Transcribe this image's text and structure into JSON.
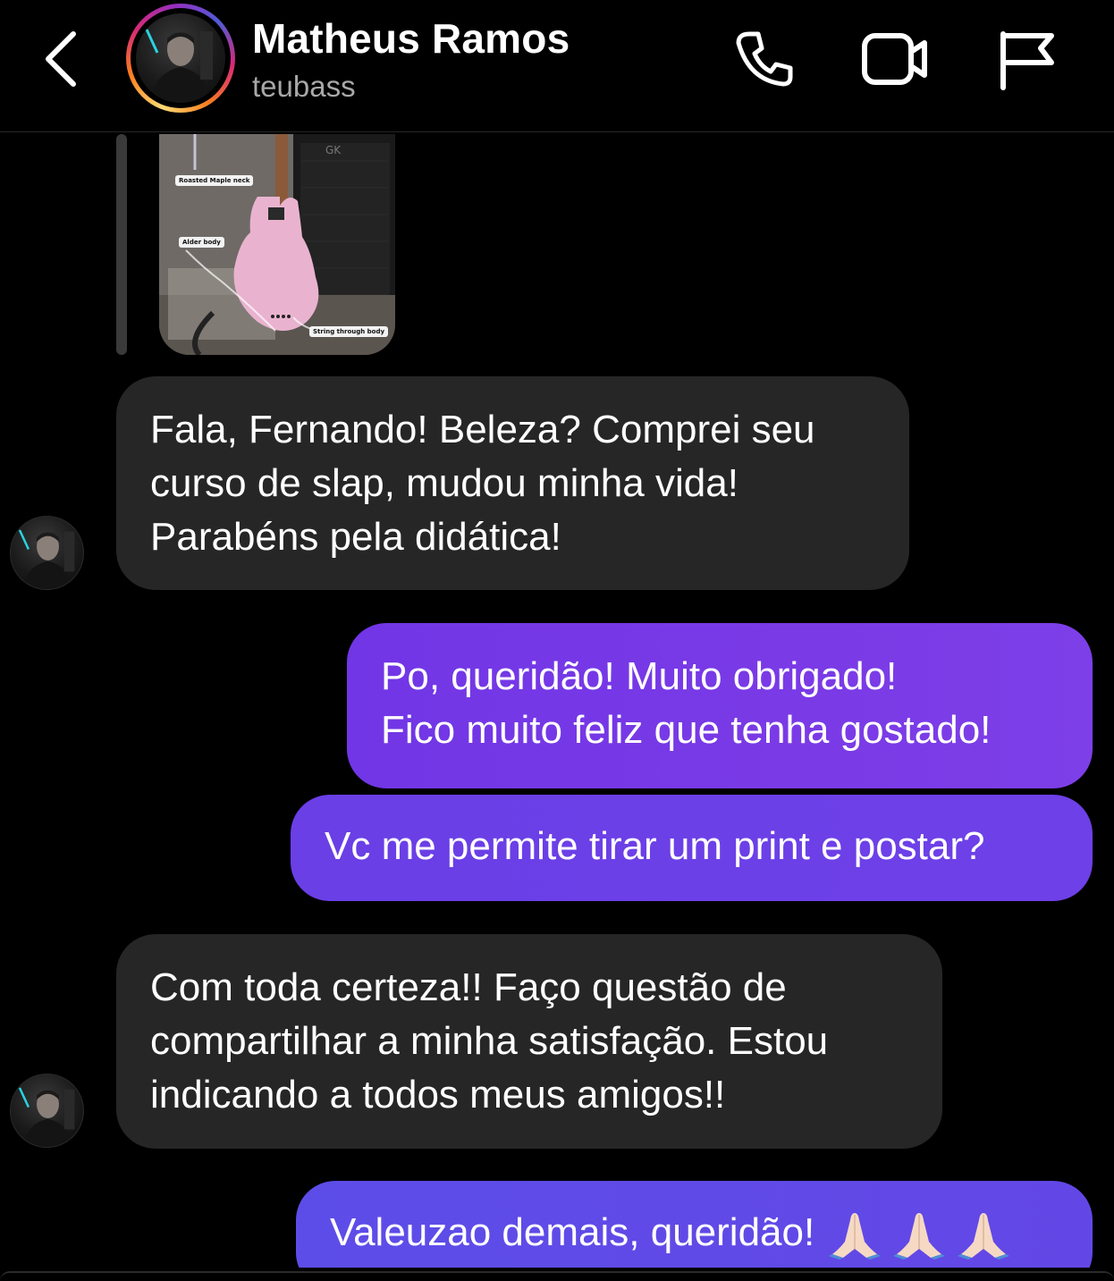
{
  "header": {
    "name": "Matheus Ramos",
    "username": "teubass"
  },
  "shared_post": {
    "labels": [
      "Roasted Maple neck",
      "Alder body",
      "String through body"
    ],
    "brand_mark": "GK"
  },
  "messages": [
    {
      "direction": "incoming",
      "text": "Fala, Fernando! Beleza? Comprei seu\ncurso de slap, mudou minha vida!\nParabéns pela didática!"
    },
    {
      "direction": "outgoing",
      "text": "Po, queridão! Muito obrigado!\nFico muito feliz que tenha gostado!"
    },
    {
      "direction": "outgoing",
      "text": "Vc me permite tirar um print e postar?"
    },
    {
      "direction": "incoming",
      "text": "Com toda certeza!! Faço questão de\ncompartilhar a minha satisfação. Estou\nindicando a todos meus amigos!!"
    },
    {
      "direction": "outgoing",
      "text": "Valeuzao demais, queridão!",
      "emoji": "folded-hands x3"
    }
  ],
  "colors": {
    "background": "#000000",
    "incoming_bubble": "#262626",
    "outgoing_bubble": "#7438e6",
    "username_gray": "#a8a8a8"
  },
  "icons": [
    "back-chevron-icon",
    "phone-icon",
    "video-camera-icon",
    "flag-icon",
    "folded-hands-emoji"
  ]
}
